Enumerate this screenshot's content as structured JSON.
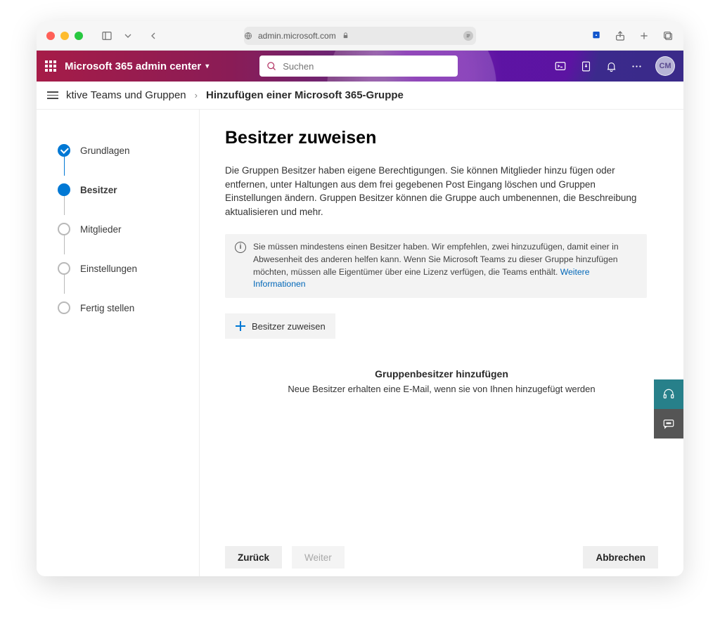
{
  "browser": {
    "url": "admin.microsoft.com"
  },
  "header": {
    "product": "Microsoft 365 admin center",
    "search_placeholder": "Suchen",
    "avatar_initials": "CM"
  },
  "breadcrumb": {
    "prev": "ktive Teams und Gruppen",
    "current": "Hinzufügen einer Microsoft 365-Gruppe"
  },
  "stepper": {
    "items": [
      {
        "label": "Grundlagen",
        "state": "done"
      },
      {
        "label": "Besitzer",
        "state": "current"
      },
      {
        "label": "Mitglieder",
        "state": "todo"
      },
      {
        "label": "Einstellungen",
        "state": "todo"
      },
      {
        "label": "Fertig stellen",
        "state": "todo"
      }
    ]
  },
  "main": {
    "title": "Besitzer zuweisen",
    "description": "Die Gruppen Besitzer haben eigene Berechtigungen. Sie können Mitglieder hinzu fügen oder entfernen, unter Haltungen aus dem frei gegebenen Post Eingang löschen und Gruppen Einstellungen ändern. Gruppen Besitzer können die Gruppe auch umbenennen, die Beschreibung aktualisieren und mehr.",
    "notice_text": "Sie müssen mindestens einen Besitzer haben. Wir empfehlen, zwei hinzuzufügen, damit einer in Abwesenheit des anderen helfen kann. Wenn Sie Microsoft Teams zu dieser Gruppe hinzufügen möchten, müssen alle Eigentümer über eine Lizenz verfügen, die Teams enthält. ",
    "notice_link": "Weitere Informationen",
    "assign_button": "Besitzer zuweisen",
    "empty_title": "Gruppenbesitzer hinzufügen",
    "empty_sub": "Neue Besitzer erhalten eine E-Mail, wenn sie von Ihnen hinzugefügt werden"
  },
  "footer": {
    "back": "Zurück",
    "next": "Weiter",
    "cancel": "Abbrechen"
  }
}
